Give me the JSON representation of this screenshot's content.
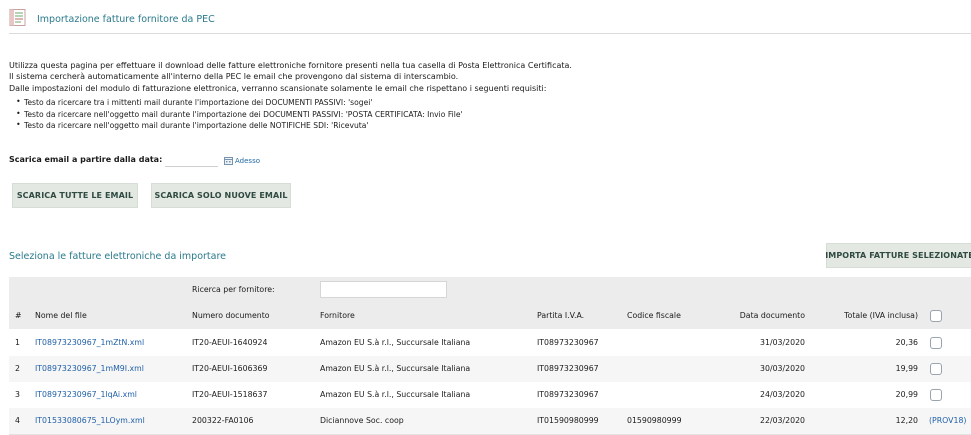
{
  "header": {
    "title": "Importazione fatture fornitore da PEC"
  },
  "intro": {
    "lines": [
      "Utilizza questa pagina per effettuare il download delle fatture elettroniche fornitore presenti nella tua casella di Posta Elettronica Certificata.",
      "Il sistema cercherà automaticamente all'interno della PEC le email che provengono dal sistema di interscambio.",
      "Dalle impostazioni del modulo di fatturazione elettronica, verranno scansionate solamente le email che rispettano i seguenti requisiti:"
    ],
    "bullets": [
      "Testo da ricercare tra i mittenti mail durante l'importazione dei DOCUMENTI PASSIVI: 'sogei'",
      "Testo da ricercare nell'oggetto mail durante l'importazione dei DOCUMENTI PASSIVI: 'POSTA CERTIFICATA: Invio File'",
      "Testo da ricercare nell'oggetto mail durante l'importazione delle NOTIFICHE SDI: 'Ricevuta'"
    ]
  },
  "date_filter": {
    "label": "Scarica email a partire dalla data:",
    "value": "",
    "now_link": "Adesso"
  },
  "buttons": {
    "download_all": "SCARICA TUTTE LE EMAIL",
    "download_new": "SCARICA SOLO NUOVE EMAIL",
    "import_selected": "IMPORTA FATTURE SELEZIONATE"
  },
  "section": {
    "title": "Seleziona le fatture elettroniche da importare"
  },
  "table": {
    "search_label": "Ricerca per fornitore:",
    "search_value": "",
    "columns": [
      "#",
      "Nome del file",
      "Numero documento",
      "Fornitore",
      "Partita I.V.A.",
      "Codice fiscale",
      "Data documento",
      "Totale (IVA inclusa)"
    ],
    "rows": [
      {
        "n": "1",
        "file": "IT08973230967_1mZtN.xml",
        "num": "IT20-AEUI-1640924",
        "supplier": "Amazon EU S.à r.l., Succursale Italiana",
        "vat": "IT08973230967",
        "cf": "",
        "date": "31/03/2020",
        "total": "20,36",
        "extra": ""
      },
      {
        "n": "2",
        "file": "IT08973230967_1mM9I.xml",
        "num": "IT20-AEUI-1606369",
        "supplier": "Amazon EU S.à r.l., Succursale Italiana",
        "vat": "IT08973230967",
        "cf": "",
        "date": "30/03/2020",
        "total": "19,99",
        "extra": ""
      },
      {
        "n": "3",
        "file": "IT08973230967_1lqAi.xml",
        "num": "IT20-AEUI-1518637",
        "supplier": "Amazon EU S.à r.l., Succursale Italiana",
        "vat": "IT08973230967",
        "cf": "",
        "date": "24/03/2020",
        "total": "20,99",
        "extra": ""
      },
      {
        "n": "4",
        "file": "IT01533080675_1LOym.xml",
        "num": "200322-FA0106",
        "supplier": "Diciannove Soc. coop",
        "vat": "IT01590980999",
        "cf": "01590980999",
        "date": "22/03/2020",
        "total": "12,20",
        "extra": "(PROV18)"
      }
    ]
  },
  "colors": {
    "accent": "#2a7a8c",
    "link": "#1f5fa8",
    "button_bg": "#e3e8e3"
  },
  "icons": {
    "header": "invoice-document-icon",
    "calendar": "calendar-icon"
  }
}
